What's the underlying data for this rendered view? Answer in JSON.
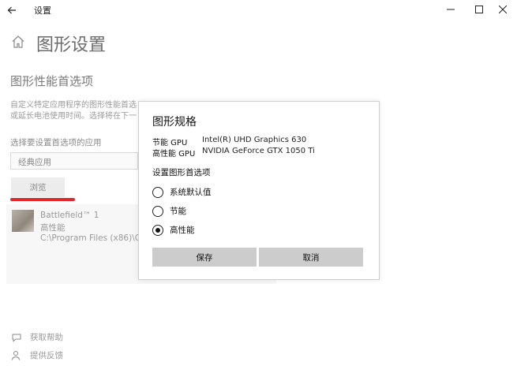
{
  "window": {
    "title": "设置"
  },
  "page": {
    "title": "图形设置",
    "section_title": "图形性能首选项",
    "description_line1": "自定义特定应用程序的图形性能首选",
    "description_line2": "或延长电池使用时间。选择将在下一",
    "choose_label": "选择要设置首选项的应用",
    "select_value": "经典应用",
    "browse_label": "浏览",
    "app": {
      "name": "Battlefield™ 1",
      "preference": "高性能",
      "path": "C:\\Program Files (x86)\\Orig"
    },
    "help_label": "获取帮助",
    "feedback_label": "提供反馈"
  },
  "dialog": {
    "title": "图形规格",
    "specs": [
      {
        "label": "节能 GPU",
        "value": "Intel(R) UHD Graphics 630"
      },
      {
        "label": "高性能 GPU",
        "value": "NVIDIA GeForce GTX 1050 Ti"
      }
    ],
    "pref_label": "设置图形首选项",
    "options": [
      {
        "label": "系统默认值",
        "selected": false
      },
      {
        "label": "节能",
        "selected": false
      },
      {
        "label": "高性能",
        "selected": true
      }
    ],
    "save_label": "保存",
    "cancel_label": "取消"
  },
  "colors": {
    "highlight_underline": "#e0282d",
    "dialog_button": "#cccccc"
  }
}
